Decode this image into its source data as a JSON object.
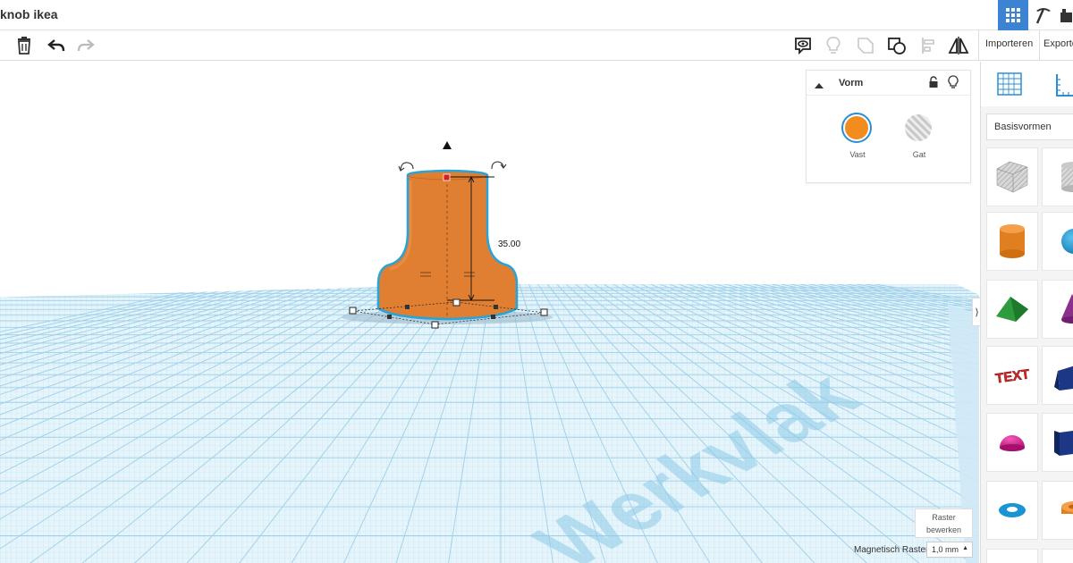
{
  "titlebar": {
    "title": "knob ikea",
    "views": [
      {
        "icon": "grid-view-icon",
        "active": true
      },
      {
        "icon": "pickaxe-icon",
        "active": false
      },
      {
        "icon": "brick-icon",
        "active": false
      }
    ]
  },
  "toolbar": {
    "left_icons": [
      "copy-icon",
      "trash-icon",
      "undo-icon",
      "redo-icon"
    ],
    "right_icons": [
      "note-icon",
      "bulb-icon",
      "group-icon",
      "ungroup-icon",
      "align-icon",
      "mirror-icon"
    ],
    "import_label": "Importeren",
    "export_label": "Exporte"
  },
  "shape_panel": {
    "title": "Vorm",
    "solid_label": "Vast",
    "hole_label": "Gat",
    "solid_color": "#f28c1f",
    "panel_icons": [
      "collapse-icon",
      "lock-icon",
      "bulb-icon"
    ]
  },
  "workplane": {
    "dimension": "35.00",
    "watermark": "Werkvlak",
    "object_color": "#e07f32",
    "outline_color": "#2aa3d6",
    "grid_color": "#a9d6ee"
  },
  "footer": {
    "raster_line1": "Raster",
    "raster_line2": "bewerken",
    "snap_label": "Magnetisch Raster",
    "snap_value": "1,0 mm"
  },
  "library": {
    "category": "Basisvormen",
    "top_icons": [
      "workplane-icon",
      "ruler-icon"
    ],
    "shapes": [
      {
        "name": "box-hole",
        "color": "#b0b0b0"
      },
      {
        "name": "cylinder-hole",
        "color": "#b0b0b0"
      },
      {
        "name": "cylinder",
        "color": "#f08a1e"
      },
      {
        "name": "sphere",
        "color": "#1e9ad6"
      },
      {
        "name": "roof",
        "color": "#2a9d3a"
      },
      {
        "name": "cone",
        "color": "#8e2e8e"
      },
      {
        "name": "text",
        "color": "#d02a2a"
      },
      {
        "name": "wedge",
        "color": "#1d3a8a"
      },
      {
        "name": "half-sphere",
        "color": "#d61f8e"
      },
      {
        "name": "box-navy",
        "color": "#1d3a8a"
      },
      {
        "name": "torus",
        "color": "#1e9ad6"
      },
      {
        "name": "tube",
        "color": "#f08a1e"
      }
    ]
  }
}
